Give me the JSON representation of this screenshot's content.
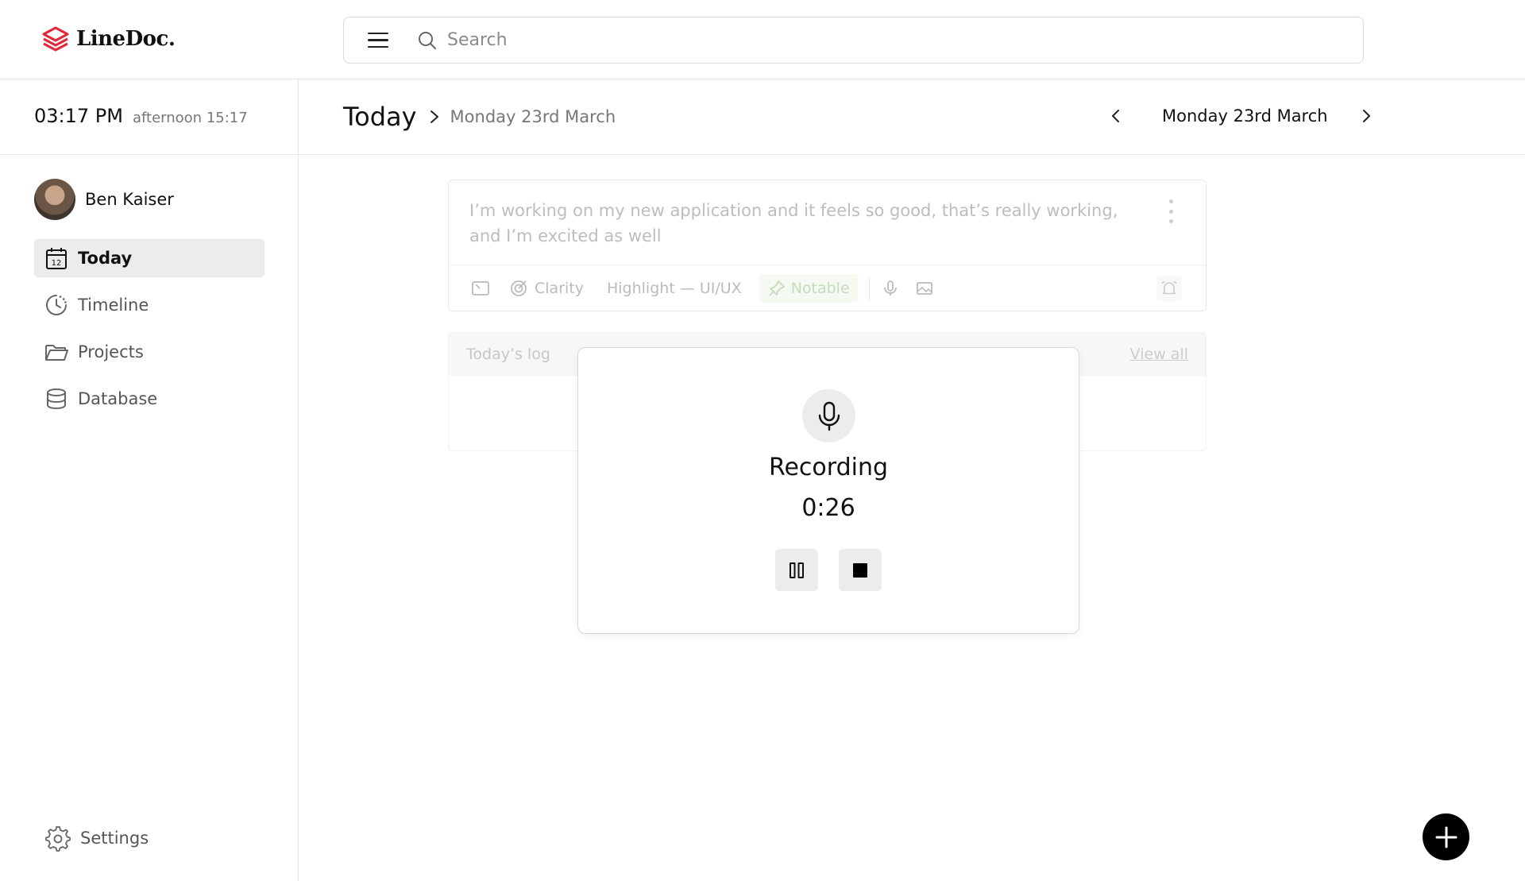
{
  "app": {
    "name": "LineDoc."
  },
  "search": {
    "placeholder": "Search"
  },
  "clock": {
    "time": "03:17 PM",
    "subtitle": "afternoon 15:17"
  },
  "user": {
    "name": "Ben Kaiser"
  },
  "sidebar": {
    "items": [
      {
        "label": "Today",
        "icon": "calendar-icon",
        "active": true
      },
      {
        "label": "Timeline",
        "icon": "timeline-icon",
        "active": false
      },
      {
        "label": "Projects",
        "icon": "folder-icon",
        "active": false
      },
      {
        "label": "Database",
        "icon": "database-icon",
        "active": false
      }
    ],
    "settings_label": "Settings"
  },
  "header": {
    "title": "Today",
    "breadcrumb": "Monday 23rd March",
    "date": "Monday 23rd March"
  },
  "entry": {
    "text": "I’m working on my new application and it feels so good, that’s really working, and I’m excited as well",
    "clarity": "Clarity",
    "highlight": "Highlight — UI/UX",
    "notable": "Notable"
  },
  "log": {
    "title": "Today’s log",
    "view_all": "View all"
  },
  "recording": {
    "title": "Recording",
    "elapsed": "0:26"
  },
  "colors": {
    "brand": "#e0283a",
    "accent": "#000000",
    "active_bg": "#ececec"
  }
}
